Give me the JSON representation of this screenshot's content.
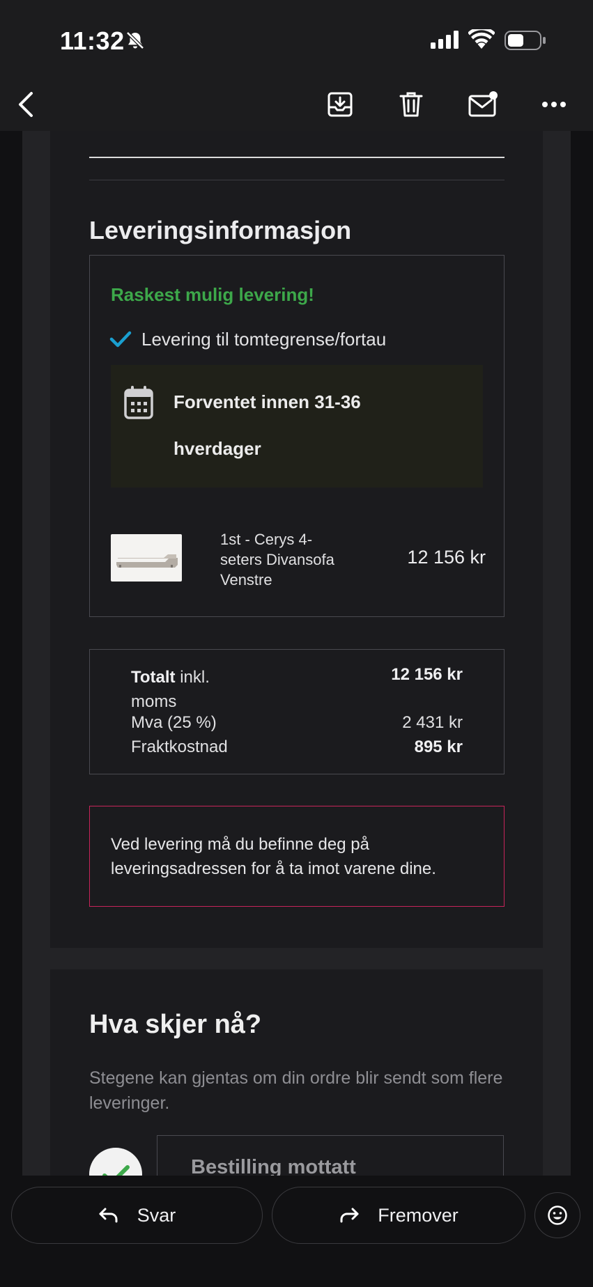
{
  "status_bar": {
    "time": "11:32"
  },
  "toolbar": {
    "back_icon": "chevron-left-icon",
    "archive_icon": "archive-icon",
    "delete_icon": "trash-icon",
    "mark_unread_icon": "mail-unread-icon",
    "more_icon": "more-icon"
  },
  "delivery": {
    "heading": "Leveringsinformasjon",
    "fast_label": "Raskest mulig levering!",
    "method": "Levering til tomtegrense/fortau",
    "eta_line1": "Forventet innen 31-36",
    "eta_line2": "hverdager",
    "product": {
      "name": "1st - Cerys 4-seters Divansofa Venstre",
      "price": "12 156 kr"
    }
  },
  "totals": {
    "total_label_bold": "Totalt",
    "total_label_rest": " inkl. moms",
    "total_value": "12 156 kr",
    "mva_label": "Mva (25 %)",
    "mva_value": "2 431 kr",
    "shipping_label": "Fraktkostnad",
    "shipping_value": "895 kr"
  },
  "notice": {
    "text": "Ved levering må du befinne deg på leveringsadressen for å ta imot varene dine."
  },
  "next_steps": {
    "heading": "Hva skjer nå?",
    "subtitle": "Stegene kan gjentas om din ordre blir sendt som flere leveringer.",
    "step1_label": "Bestilling mottatt"
  },
  "actions": {
    "reply": "Svar",
    "forward": "Fremover"
  },
  "colors": {
    "accent_green": "#3da84a",
    "check_blue": "#1a9fd0",
    "notice_border": "#c8245a"
  }
}
